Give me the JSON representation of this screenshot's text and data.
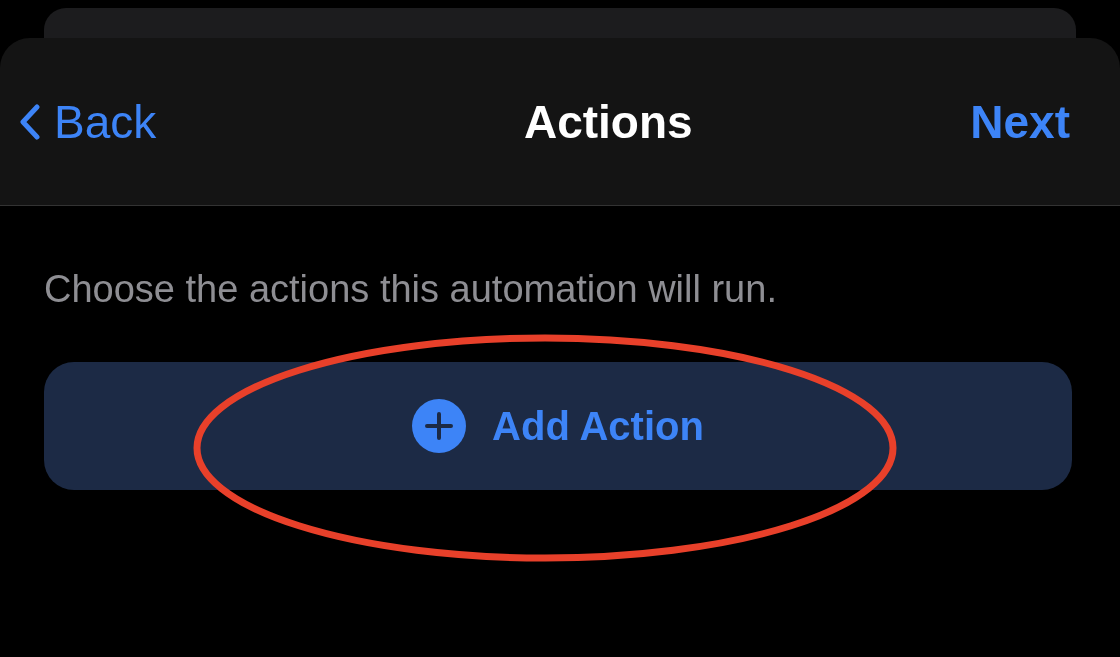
{
  "nav": {
    "back": "Back",
    "title": "Actions",
    "next": "Next"
  },
  "description": "Choose the actions this automation will run.",
  "add_button": {
    "label": "Add Action"
  },
  "annotation": {
    "kind": "ellipse"
  }
}
